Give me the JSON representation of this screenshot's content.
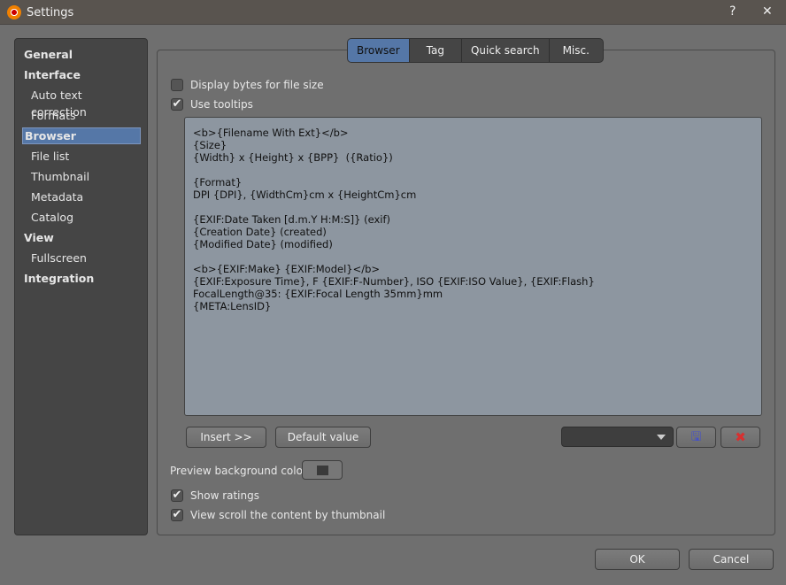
{
  "window": {
    "title": "Settings",
    "help": "?",
    "close": "✕"
  },
  "sidebar": {
    "items": [
      {
        "label": "General",
        "level": "top"
      },
      {
        "label": "Interface",
        "level": "top"
      },
      {
        "label": "Auto text correction",
        "level": "sub"
      },
      {
        "label": "Formats",
        "level": "sub"
      },
      {
        "label": "Browser",
        "level": "top",
        "selected": true
      },
      {
        "label": "File list",
        "level": "sub"
      },
      {
        "label": "Thumbnail",
        "level": "sub"
      },
      {
        "label": "Metadata",
        "level": "sub"
      },
      {
        "label": "Catalog",
        "level": "sub"
      },
      {
        "label": "View",
        "level": "top"
      },
      {
        "label": "Fullscreen",
        "level": "sub"
      },
      {
        "label": "Integration",
        "level": "top"
      }
    ]
  },
  "tabs": [
    "Browser",
    "Tag",
    "Quick search",
    "Misc."
  ],
  "options": {
    "display_bytes": {
      "label": "Display bytes for file size",
      "checked": false
    },
    "use_tooltips": {
      "label": "Use tooltips",
      "checked": true
    },
    "show_ratings": {
      "label": "Show ratings",
      "checked": true
    },
    "view_scroll": {
      "label": "View scroll the content by thumbnail",
      "checked": true
    }
  },
  "tooltip_template": "<b>{Filename With Ext}</b>\n{Size}\n{Width} x {Height} x {BPP}  ({Ratio})\n\n{Format}\nDPI {DPI}, {WidthCm}cm x {HeightCm}cm\n\n{EXIF:Date Taken [d.m.Y H:M:S]} (exif)\n{Creation Date} (created)\n{Modified Date} (modified)\n\n<b>{EXIF:Make} {EXIF:Model}</b>\n{EXIF:Exposure Time}, F {EXIF:F-Number}, ISO {EXIF:ISO Value}, {EXIF:Flash}\nFocalLength@35: {EXIF:Focal Length 35mm}mm\n{META:LensID}",
  "buttons": {
    "insert": "Insert >>",
    "default": "Default value",
    "ok": "OK",
    "cancel": "Cancel"
  },
  "preview_bg_label": "Preview background color"
}
